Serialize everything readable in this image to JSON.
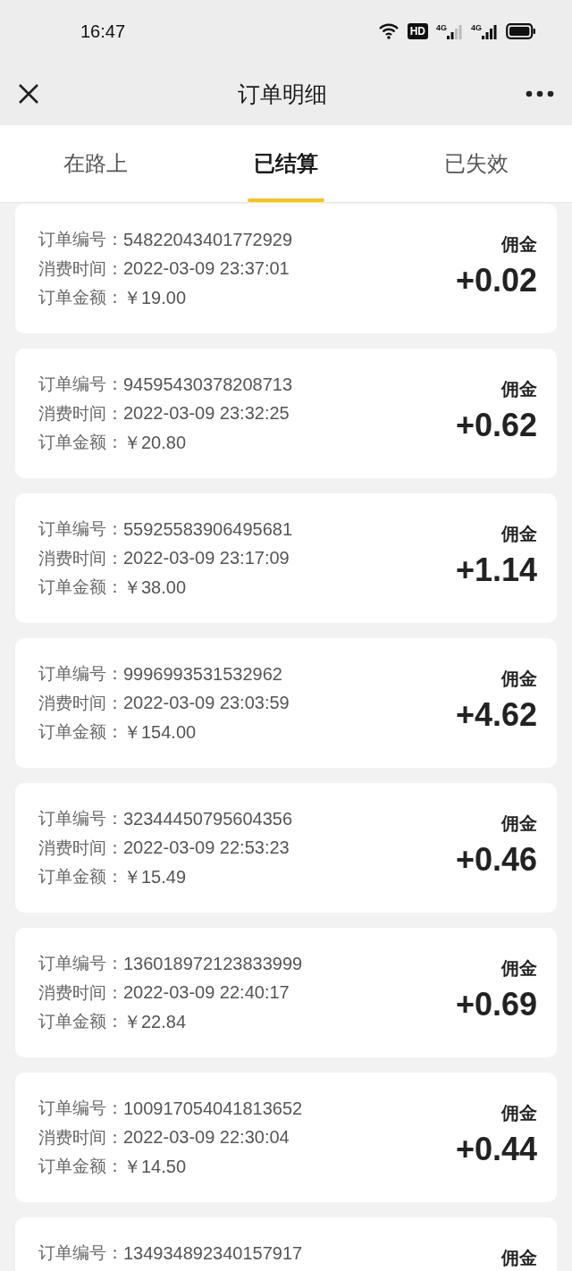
{
  "status_bar": {
    "time": "16:47",
    "hd_badge": "HD",
    "signals": [
      {
        "label": "4G",
        "kind": "weak"
      },
      {
        "label": "4G",
        "kind": "full"
      }
    ]
  },
  "header": {
    "title": "订单明细"
  },
  "tabs": [
    {
      "label": "在路上",
      "selected": false
    },
    {
      "label": "已结算",
      "selected": true
    },
    {
      "label": "已失效",
      "selected": false
    }
  ],
  "orders": [
    {
      "fields": [
        {
          "label": "订单编号：",
          "value": "54822043401772929"
        },
        {
          "label": "消费时间：",
          "value": "2022-03-09 23:37:01"
        },
        {
          "label": "订单金额：",
          "value": "￥19.00"
        }
      ],
      "commission_label": "佣金",
      "commission": "+0.02"
    },
    {
      "fields": [
        {
          "label": "订单编号：",
          "value": "94595430378208713"
        },
        {
          "label": "消费时间：",
          "value": "2022-03-09 23:32:25"
        },
        {
          "label": "订单金额：",
          "value": "￥20.80"
        }
      ],
      "commission_label": "佣金",
      "commission": "+0.62"
    },
    {
      "fields": [
        {
          "label": "订单编号：",
          "value": "55925583906495681"
        },
        {
          "label": "消费时间：",
          "value": "2022-03-09 23:17:09"
        },
        {
          "label": "订单金额：",
          "value": "￥38.00"
        }
      ],
      "commission_label": "佣金",
      "commission": "+1.14"
    },
    {
      "fields": [
        {
          "label": "订单编号：",
          "value": "9996993531532962"
        },
        {
          "label": "消费时间：",
          "value": "2022-03-09 23:03:59"
        },
        {
          "label": "订单金额：",
          "value": "￥154.00"
        }
      ],
      "commission_label": "佣金",
      "commission": "+4.62"
    },
    {
      "fields": [
        {
          "label": "订单编号：",
          "value": "32344450795604356"
        },
        {
          "label": "消费时间：",
          "value": "2022-03-09 22:53:23"
        },
        {
          "label": "订单金额：",
          "value": "￥15.49"
        }
      ],
      "commission_label": "佣金",
      "commission": "+0.46"
    },
    {
      "fields": [
        {
          "label": "订单编号：",
          "value": "136018972123833999"
        },
        {
          "label": "消费时间：",
          "value": "2022-03-09 22:40:17"
        },
        {
          "label": "订单金额：",
          "value": "￥22.84"
        }
      ],
      "commission_label": "佣金",
      "commission": "+0.69"
    },
    {
      "fields": [
        {
          "label": "订单编号：",
          "value": "100917054041813652"
        },
        {
          "label": "消费时间：",
          "value": "2022-03-09 22:30:04"
        },
        {
          "label": "订单金额：",
          "value": "￥14.50"
        }
      ],
      "commission_label": "佣金",
      "commission": "+0.44"
    },
    {
      "fields": [
        {
          "label": "订单编号：",
          "value": "134934892340157917"
        }
      ],
      "commission_label": "佣金"
    }
  ]
}
